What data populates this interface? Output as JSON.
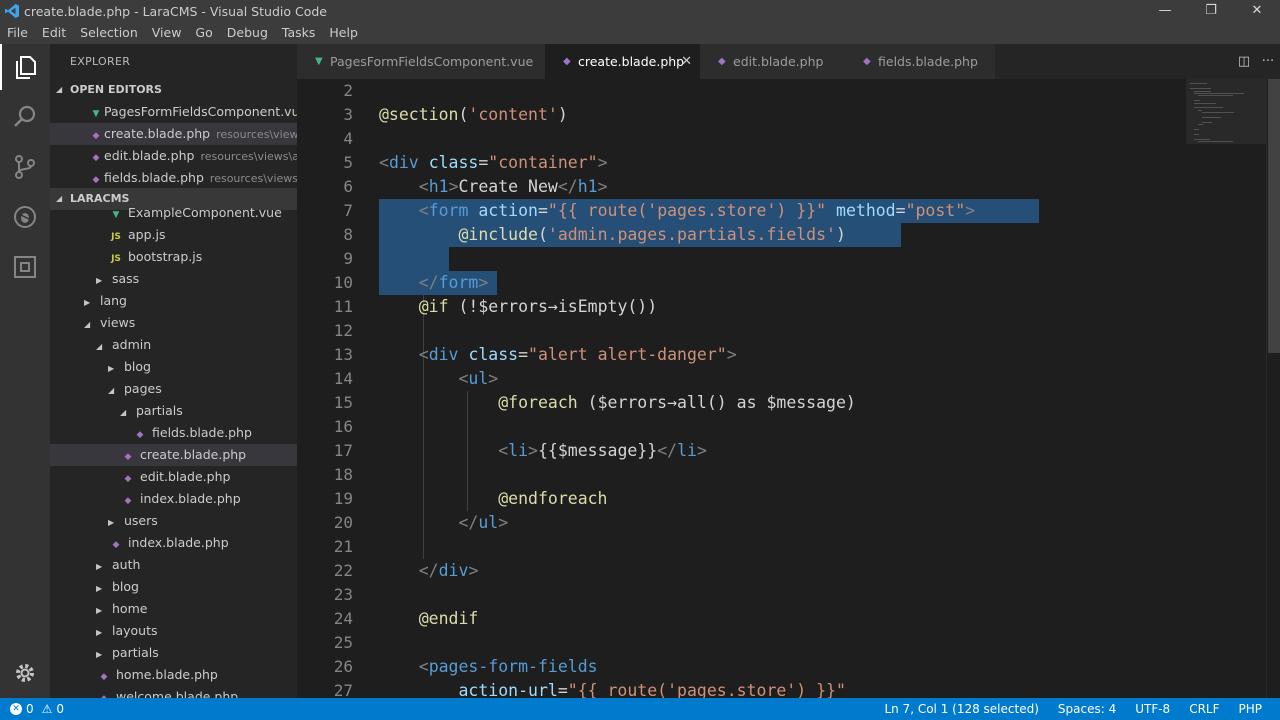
{
  "window": {
    "title": "create.blade.php - LaraCMS - Visual Studio Code",
    "controls": {
      "minimize": "—",
      "maximize": "❐",
      "close": "✕"
    }
  },
  "menu": [
    "File",
    "Edit",
    "Selection",
    "View",
    "Go",
    "Debug",
    "Tasks",
    "Help"
  ],
  "activity_bar": [
    "files-icon",
    "search-icon",
    "source-control-icon",
    "debug-icon",
    "extensions-icon",
    "settings-gear-icon"
  ],
  "sidebar": {
    "title": "EXPLORER",
    "open_editors_header": "OPEN EDITORS",
    "open_editors": [
      {
        "name": "PagesFormFieldsComponent.vu...",
        "desc": "",
        "icon": "V"
      },
      {
        "name": "create.blade.php",
        "desc": "resources\\views...",
        "icon": "php"
      },
      {
        "name": "edit.blade.php",
        "desc": "resources\\views\\a...",
        "icon": "php"
      },
      {
        "name": "fields.blade.php",
        "desc": "resources\\views\\...",
        "icon": "php"
      }
    ],
    "project_header": "LARACMS",
    "tree": [
      {
        "name": "ExampleComponent.vue",
        "icon": "V",
        "twisty": ""
      },
      {
        "name": "app.js",
        "icon": "JS",
        "twisty": ""
      },
      {
        "name": "bootstrap.js",
        "icon": "JS",
        "twisty": ""
      },
      {
        "name": "sass",
        "icon": "",
        "twisty": "▶"
      },
      {
        "name": "lang",
        "icon": "",
        "twisty": "▶"
      },
      {
        "name": "views",
        "icon": "",
        "twisty": "◢"
      },
      {
        "name": "admin",
        "icon": "",
        "twisty": "◢"
      },
      {
        "name": "blog",
        "icon": "",
        "twisty": "▶"
      },
      {
        "name": "pages",
        "icon": "",
        "twisty": "◢"
      },
      {
        "name": "partials",
        "icon": "",
        "twisty": "◢"
      },
      {
        "name": "fields.blade.php",
        "icon": "php",
        "twisty": ""
      },
      {
        "name": "create.blade.php",
        "icon": "php",
        "twisty": ""
      },
      {
        "name": "edit.blade.php",
        "icon": "php",
        "twisty": ""
      },
      {
        "name": "index.blade.php",
        "icon": "php",
        "twisty": ""
      },
      {
        "name": "users",
        "icon": "",
        "twisty": "▶"
      },
      {
        "name": "index.blade.php",
        "icon": "php",
        "twisty": ""
      },
      {
        "name": "auth",
        "icon": "",
        "twisty": "▶"
      },
      {
        "name": "blog",
        "icon": "",
        "twisty": "▶"
      },
      {
        "name": "home",
        "icon": "",
        "twisty": "▶"
      },
      {
        "name": "layouts",
        "icon": "",
        "twisty": "▶"
      },
      {
        "name": "partials",
        "icon": "",
        "twisty": "▶"
      },
      {
        "name": "home.blade.php",
        "icon": "php",
        "twisty": ""
      },
      {
        "name": "welcome.blade.php",
        "icon": "php",
        "twisty": ""
      }
    ]
  },
  "tabs": [
    {
      "label": "PagesFormFieldsComponent.vue",
      "icon": "V"
    },
    {
      "label": "create.blade.php",
      "icon": "php",
      "close": "✕"
    },
    {
      "label": "edit.blade.php",
      "icon": "php"
    },
    {
      "label": "fields.blade.php",
      "icon": "php"
    }
  ],
  "editor": {
    "lines": [
      {
        "num": "2",
        "tokens": []
      },
      {
        "num": "3",
        "tokens": [
          [
            "dir",
            "@section"
          ],
          [
            "def",
            "("
          ],
          [
            "str",
            "'content'"
          ],
          [
            "def",
            ")"
          ]
        ]
      },
      {
        "num": "4",
        "tokens": []
      },
      {
        "num": "5",
        "tokens": [
          [
            "brk",
            "<"
          ],
          [
            "tag",
            "div"
          ],
          [
            "def",
            " "
          ],
          [
            "attr",
            "class"
          ],
          [
            "def",
            "="
          ],
          [
            "str",
            "\"container\""
          ],
          [
            "brk",
            ">"
          ]
        ]
      },
      {
        "num": "6",
        "tokens": [
          [
            "def",
            "    "
          ],
          [
            "brk",
            "<"
          ],
          [
            "tag",
            "h1"
          ],
          [
            "brk",
            ">"
          ],
          [
            "def",
            "Create New"
          ],
          [
            "brk",
            "</"
          ],
          [
            "tag",
            "h1"
          ],
          [
            "brk",
            ">"
          ]
        ]
      },
      {
        "num": "7",
        "tokens": [
          [
            "def",
            "    "
          ],
          [
            "brk",
            "<"
          ],
          [
            "tag",
            "form"
          ],
          [
            "def",
            " "
          ],
          [
            "attr",
            "action"
          ],
          [
            "def",
            "="
          ],
          [
            "str",
            "\"{{ route('pages.store') }}\""
          ],
          [
            "def",
            " "
          ],
          [
            "attr",
            "method"
          ],
          [
            "def",
            "="
          ],
          [
            "str",
            "\"post\""
          ],
          [
            "brk",
            ">"
          ]
        ]
      },
      {
        "num": "8",
        "tokens": [
          [
            "def",
            "        "
          ],
          [
            "dir",
            "@include"
          ],
          [
            "def",
            "("
          ],
          [
            "str",
            "'admin.pages.partials.fields'"
          ],
          [
            "def",
            ")"
          ]
        ]
      },
      {
        "num": "9",
        "tokens": []
      },
      {
        "num": "10",
        "tokens": [
          [
            "def",
            "    "
          ],
          [
            "brk",
            "</"
          ],
          [
            "tag",
            "form"
          ],
          [
            "brk",
            ">"
          ]
        ]
      },
      {
        "num": "11",
        "tokens": [
          [
            "def",
            "    "
          ],
          [
            "dir",
            "@if"
          ],
          [
            "def",
            " (!$errors→isEmpty())"
          ]
        ]
      },
      {
        "num": "12",
        "tokens": []
      },
      {
        "num": "13",
        "tokens": [
          [
            "def",
            "    "
          ],
          [
            "brk",
            "<"
          ],
          [
            "tag",
            "div"
          ],
          [
            "def",
            " "
          ],
          [
            "attr",
            "class"
          ],
          [
            "def",
            "="
          ],
          [
            "str",
            "\"alert alert-danger\""
          ],
          [
            "brk",
            ">"
          ]
        ]
      },
      {
        "num": "14",
        "tokens": [
          [
            "def",
            "        "
          ],
          [
            "brk",
            "<"
          ],
          [
            "tag",
            "ul"
          ],
          [
            "brk",
            ">"
          ]
        ]
      },
      {
        "num": "15",
        "tokens": [
          [
            "def",
            "            "
          ],
          [
            "dir",
            "@foreach"
          ],
          [
            "def",
            " ($errors→all() as $message)"
          ]
        ]
      },
      {
        "num": "16",
        "tokens": []
      },
      {
        "num": "17",
        "tokens": [
          [
            "def",
            "            "
          ],
          [
            "brk",
            "<"
          ],
          [
            "tag",
            "li"
          ],
          [
            "brk",
            ">"
          ],
          [
            "def",
            "{{$message}}"
          ],
          [
            "brk",
            "</"
          ],
          [
            "tag",
            "li"
          ],
          [
            "brk",
            ">"
          ]
        ]
      },
      {
        "num": "18",
        "tokens": []
      },
      {
        "num": "19",
        "tokens": [
          [
            "def",
            "            "
          ],
          [
            "dir",
            "@endforeach"
          ]
        ]
      },
      {
        "num": "20",
        "tokens": [
          [
            "def",
            "        "
          ],
          [
            "brk",
            "</"
          ],
          [
            "tag",
            "ul"
          ],
          [
            "brk",
            ">"
          ]
        ]
      },
      {
        "num": "21",
        "tokens": []
      },
      {
        "num": "22",
        "tokens": [
          [
            "def",
            "    "
          ],
          [
            "brk",
            "</"
          ],
          [
            "tag",
            "div"
          ],
          [
            "brk",
            ">"
          ]
        ]
      },
      {
        "num": "23",
        "tokens": []
      },
      {
        "num": "24",
        "tokens": [
          [
            "def",
            "    "
          ],
          [
            "dir",
            "@endif"
          ]
        ]
      },
      {
        "num": "25",
        "tokens": []
      },
      {
        "num": "26",
        "tokens": [
          [
            "def",
            "    "
          ],
          [
            "brk",
            "<"
          ],
          [
            "tag",
            "pages-form-fields"
          ]
        ]
      },
      {
        "num": "27",
        "tokens": [
          [
            "def",
            "        "
          ],
          [
            "attr",
            "action-url"
          ],
          [
            "def",
            "="
          ],
          [
            "str",
            "\"{{ route('pages.store') }}\""
          ]
        ]
      }
    ]
  },
  "status": {
    "errors": "0",
    "warnings": "0",
    "position": "Ln 7, Col 1 (128 selected)",
    "spaces": "Spaces: 4",
    "encoding": "UTF-8",
    "eol": "CRLF",
    "language": "PHP"
  }
}
